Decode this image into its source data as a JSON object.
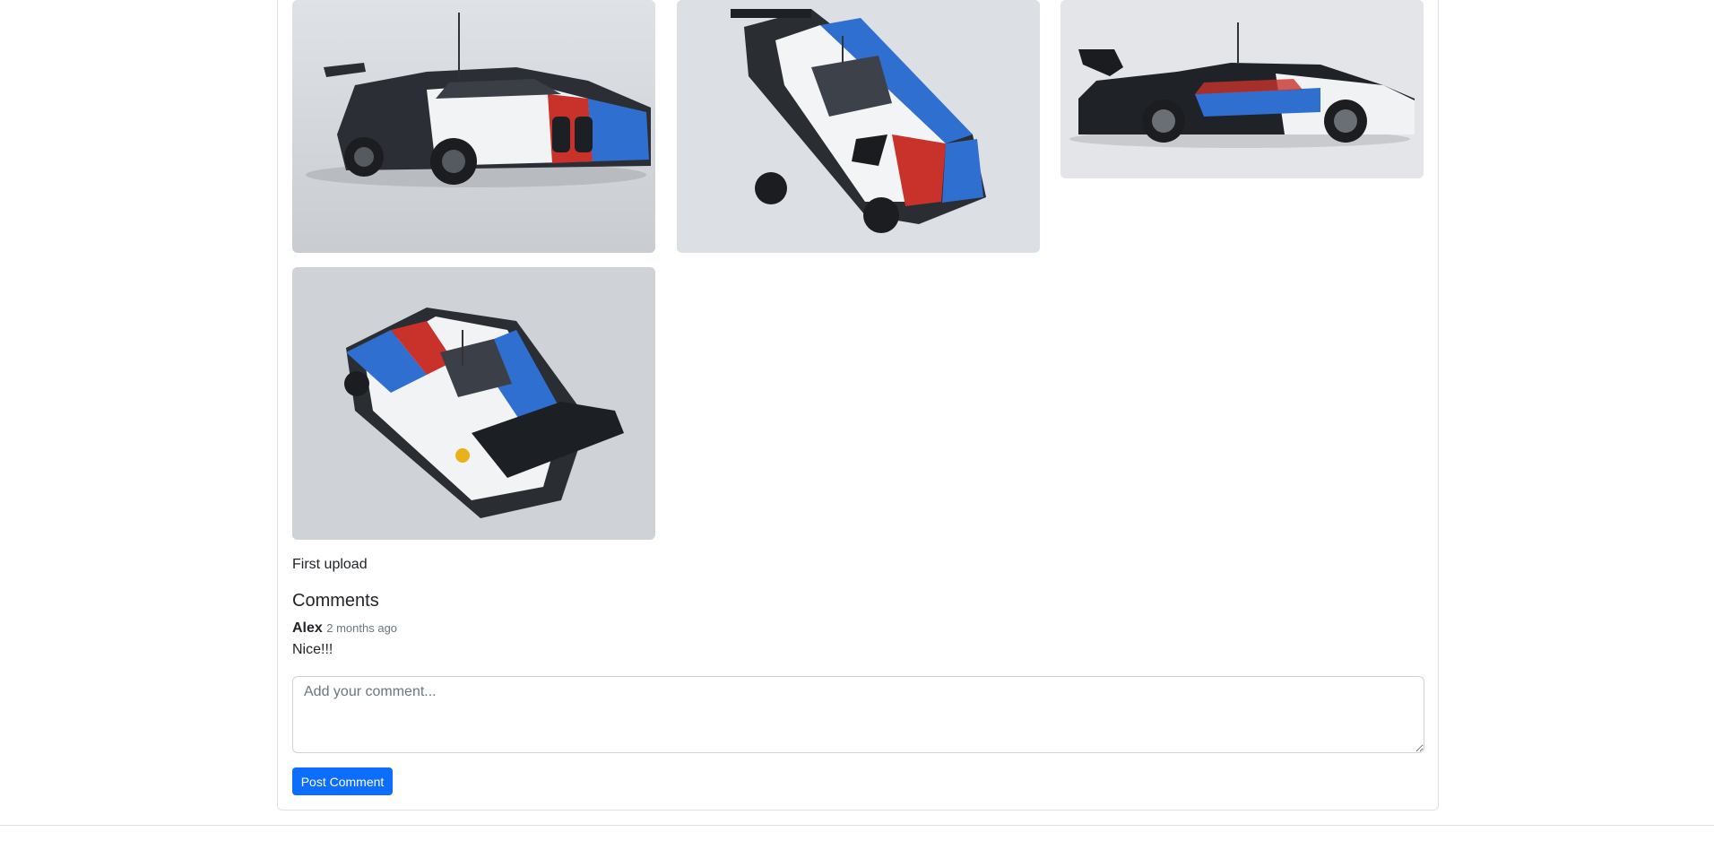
{
  "post": {
    "photos": [
      {
        "name": "car-front-three-quarter-photo"
      },
      {
        "name": "car-top-front-photo"
      },
      {
        "name": "car-side-profile-photo"
      },
      {
        "name": "car-top-rear-photo"
      }
    ],
    "caption": "First upload"
  },
  "comments": {
    "heading": "Comments",
    "items": [
      {
        "author": "Alex",
        "time": "2 months ago",
        "text": "Nice!!!"
      }
    ],
    "input_placeholder": "Add your comment...",
    "submit_label": "Post Comment"
  },
  "colors": {
    "accent": "#0d6efd",
    "border": "#dee2e6",
    "muted_text": "#6c757d",
    "livery_blue": "#2f6fd0",
    "livery_red": "#c8322b",
    "livery_dark": "#1f2328"
  }
}
